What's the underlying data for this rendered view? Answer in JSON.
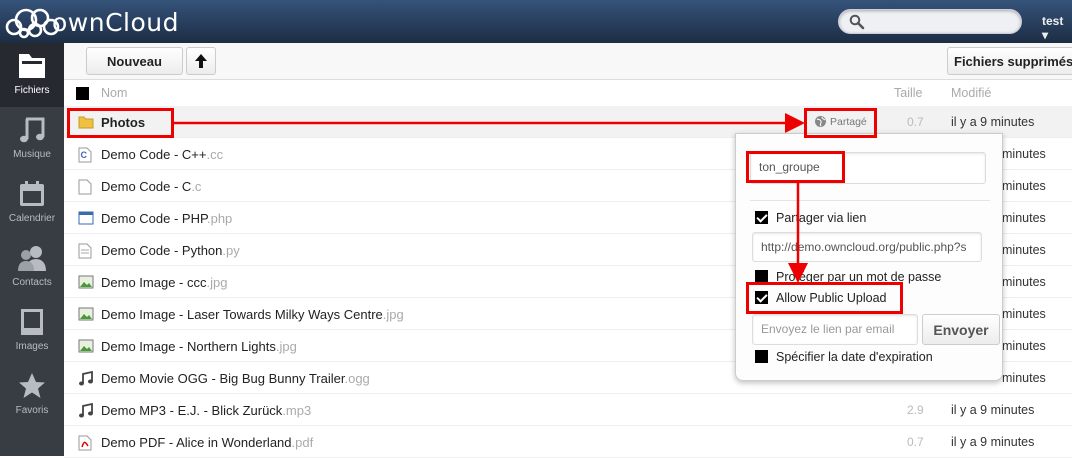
{
  "app": {
    "logo_text": "ownCloud",
    "user": "test ▾"
  },
  "sidebar": {
    "items": [
      {
        "label": "Fichiers",
        "icon": "folder-icon"
      },
      {
        "label": "Musique",
        "icon": "music-icon"
      },
      {
        "label": "Calendrier",
        "icon": "calendar-icon"
      },
      {
        "label": "Contacts",
        "icon": "contacts-icon"
      },
      {
        "label": "Images",
        "icon": "images-icon"
      },
      {
        "label": "Favoris",
        "icon": "star-icon"
      }
    ]
  },
  "toolbar": {
    "new_label": "Nouveau",
    "deleted_label": "Fichiers supprimés"
  },
  "table": {
    "headers": {
      "name": "Nom",
      "size": "Taille",
      "modified": "Modifié"
    }
  },
  "files": [
    {
      "name": "Photos",
      "ext": "",
      "type": "folder",
      "size": "0.7",
      "modified": "il y a 9 minutes",
      "share_label": "Partagé"
    },
    {
      "name": "Demo Code - C++",
      "ext": ".cc",
      "type": "code-c",
      "size": "",
      "modified": "minutes"
    },
    {
      "name": "Demo Code - C",
      "ext": ".c",
      "type": "file",
      "size": "",
      "modified": "minutes"
    },
    {
      "name": "Demo Code - PHP",
      "ext": ".php",
      "type": "window",
      "size": "",
      "modified": "minutes"
    },
    {
      "name": "Demo Code - Python",
      "ext": ".py",
      "type": "text",
      "size": "",
      "modified": "minutes"
    },
    {
      "name": "Demo Image - ccc",
      "ext": ".jpg",
      "type": "image",
      "size": "",
      "modified": "minutes"
    },
    {
      "name": "Demo Image - Laser Towards Milky Ways Centre",
      "ext": ".jpg",
      "type": "image",
      "size": "",
      "modified": "minutes"
    },
    {
      "name": "Demo Image - Northern Lights",
      "ext": ".jpg",
      "type": "image",
      "size": "",
      "modified": "minutes"
    },
    {
      "name": "Demo Movie OGG - Big Bug Bunny Trailer",
      "ext": ".ogg",
      "type": "audio",
      "size": "",
      "modified": "minutes"
    },
    {
      "name": "Demo MP3 - E.J. - Blick Zurück",
      "ext": ".mp3",
      "type": "audio",
      "size": "2.9",
      "modified": "il y a 9 minutes"
    },
    {
      "name": "Demo PDF - Alice in Wonderland",
      "ext": ".pdf",
      "type": "pdf",
      "size": "0.7",
      "modified": "il y a 9 minutes"
    }
  ],
  "share_dialog": {
    "share_with_value": "ton_groupe",
    "share_link_label": "Partager via lien",
    "link_value": "http://demo.owncloud.org/public.php?s",
    "password_label": "Protéger par un mot de passe",
    "public_upload_label": "Allow Public Upload",
    "email_placeholder": "Envoyez le lien par email",
    "send_label": "Envoyer",
    "expiration_label": "Spécifier la date d'expiration"
  },
  "colors": {
    "topbar": "#1d2d44",
    "sidebar": "#383c43",
    "annotation": "#e00000"
  }
}
